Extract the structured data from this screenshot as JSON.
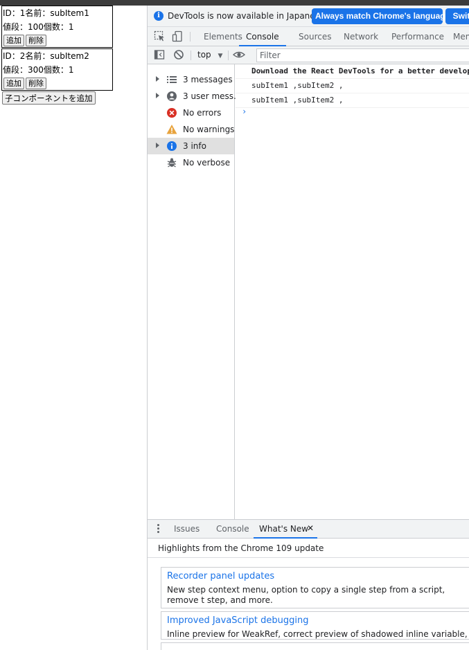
{
  "page": {
    "items": [
      {
        "line1": "ID：1名前：subItem1",
        "line2": "値段：100個数：1",
        "add": "追加",
        "delete": "削除"
      },
      {
        "line1": "ID：2名前：subItem2",
        "line2": "値段：300個数：1",
        "add": "追加",
        "delete": "削除"
      }
    ],
    "add_child_button": "子コンポーネントを追加"
  },
  "devtools": {
    "infobar": {
      "text": "DevTools is now available in Japanese!",
      "match_button": "Always match Chrome's language",
      "switch_button": "Switch"
    },
    "tabs": [
      "Elements",
      "Console",
      "Sources",
      "Network",
      "Performance",
      "Mem"
    ],
    "active_tab": "Console",
    "toolbar": {
      "context": "top",
      "filter_placeholder": "Filter"
    },
    "sidebar": [
      {
        "label": "3 messages",
        "icon": "list-icon"
      },
      {
        "label": "3 user mess...",
        "icon": "user-icon"
      },
      {
        "label": "No errors",
        "icon": "error-icon"
      },
      {
        "label": "No warnings",
        "icon": "warning-icon"
      },
      {
        "label": "3 info",
        "icon": "info-icon"
      },
      {
        "label": "No verbose",
        "icon": "bug-icon"
      }
    ],
    "console_lines": [
      "Download the React DevTools for a better develop",
      "subItem1 ,subItem2 ,",
      "subItem1 ,subItem2 ,"
    ],
    "prompt": "›",
    "drawer": {
      "tabs": [
        "Issues",
        "Console",
        "What's New"
      ],
      "close": "✕"
    },
    "whats_new": {
      "highlights": "Highlights from the Chrome 109 update",
      "cards": [
        {
          "title": "Recorder panel updates",
          "desc": "New step context menu, option to copy a single step from a script, remove t step, and more."
        },
        {
          "title": "Improved JavaScript debugging",
          "desc": "Inline preview for WeakRef, correct preview of shadowed inline variable, and"
        }
      ]
    },
    "colors": {
      "accent": "#1a73e8",
      "error": "#d93025",
      "warning": "#e8a33d",
      "toolbar_bg": "#f1f3f4"
    }
  }
}
